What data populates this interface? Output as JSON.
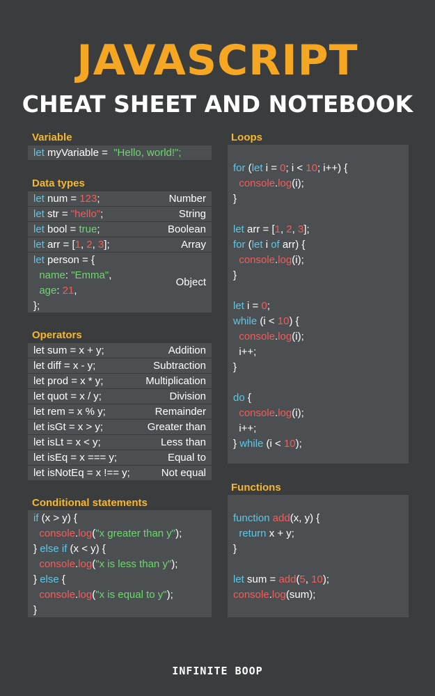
{
  "header": {
    "title": "JAVASCRIPT",
    "subtitle": "CHEAT SHEET AND NOTEBOOK"
  },
  "sections": {
    "variable": "Variable",
    "data_types": "Data types",
    "operators": "Operators",
    "conditional": "Conditional statements",
    "loops": "Loops",
    "functions": "Functions"
  },
  "variable": {
    "line1": "myVariable = ",
    "line1_str": "\"Hello, world!\";"
  },
  "data_types": {
    "num_desc": "Number",
    "str_desc": "String",
    "bool_desc": "Boolean",
    "arr_desc": "Array",
    "obj_desc": "Object"
  },
  "operators": {
    "rows": [
      {
        "code": "let sum = x + y;",
        "desc": "Addition"
      },
      {
        "code": "let diff = x - y;",
        "desc": "Subtraction"
      },
      {
        "code": "let prod = x * y;",
        "desc": "Multiplication"
      },
      {
        "code": "let quot = x / y;",
        "desc": "Division"
      },
      {
        "code": "let rem = x % y;",
        "desc": "Remainder"
      },
      {
        "code": "let isGt = x > y;",
        "desc": "Greater than"
      },
      {
        "code": "let isLt = x < y;",
        "desc": "Less than"
      },
      {
        "code": "let isEq = x === y;",
        "desc": "Equal to"
      },
      {
        "code": "let isNotEq = x !== y;",
        "desc": "Not equal"
      }
    ]
  },
  "footer": {
    "brand": "INFINITE BOOP"
  },
  "colors": {
    "background": "#3b3c3d",
    "panel": "#4b4f51",
    "title": "#f5a623",
    "section_label": "#f5b82e",
    "keyword": "#5cc8e8",
    "string": "#6fd66f",
    "number": "#f25c5c"
  }
}
